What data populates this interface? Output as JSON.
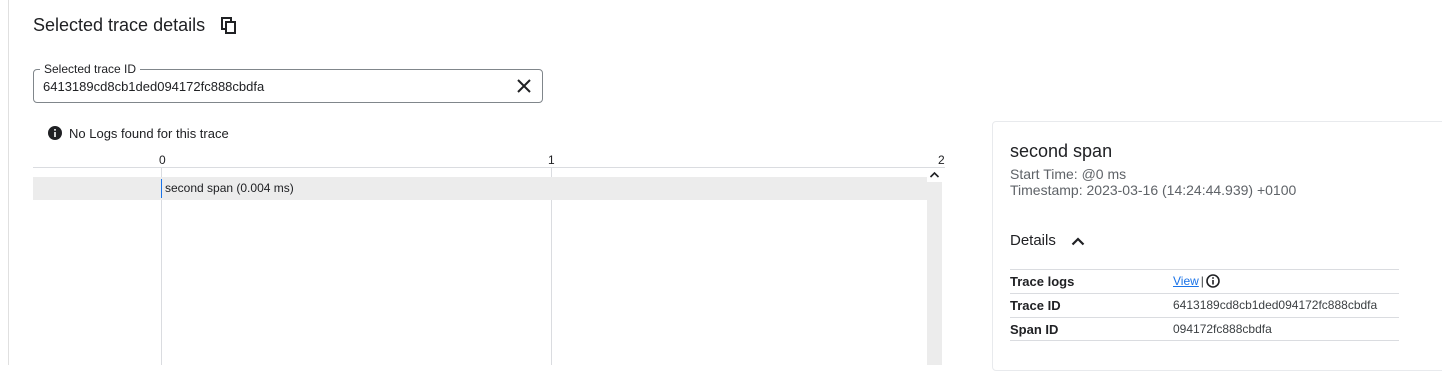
{
  "page": {
    "title": "Selected trace details"
  },
  "trace_field": {
    "label": "Selected trace ID",
    "value": "6413189cd8cb1ded094172fc888cbdfa"
  },
  "notice": {
    "text": "No Logs found for this trace"
  },
  "timeline": {
    "ticks": [
      "0",
      "1",
      "2"
    ],
    "spans": [
      {
        "label": "second span (0.004 ms)"
      }
    ]
  },
  "span_details": {
    "title": "second span",
    "start_time": "Start Time: @0 ms",
    "timestamp": "Timestamp: 2023-03-16 (14:24:44.939) +0100",
    "details_label": "Details",
    "rows": [
      {
        "key": "Trace logs",
        "value": "View"
      },
      {
        "key": "Trace ID",
        "value": "6413189cd8cb1ded094172fc888cbdfa"
      },
      {
        "key": "Span ID",
        "value": "094172fc888cbdfa"
      }
    ]
  },
  "icons": {
    "copy": "copy-icon",
    "clear": "close-icon",
    "info": "info-icon",
    "collapse": "chevron-up-icon",
    "scroll_up": "chevron-up-icon"
  },
  "colors": {
    "accent": "#1a73e8",
    "row_bg": "#ececec",
    "muted_text": "#5f6368"
  }
}
